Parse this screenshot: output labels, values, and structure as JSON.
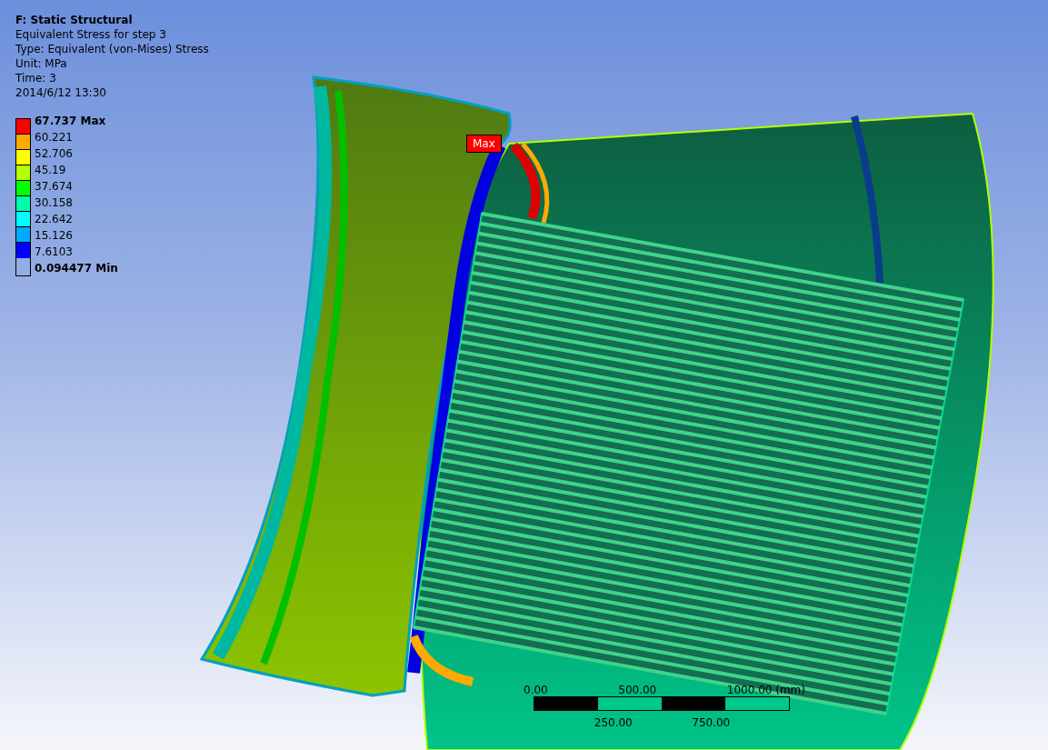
{
  "header": {
    "title": "F: Static Structural",
    "lines": [
      "Equivalent Stress for step 3",
      "Type: Equivalent (von-Mises) Stress",
      "Unit: MPa",
      "Time: 3",
      "2014/6/12 13:30"
    ]
  },
  "legend": {
    "labels": [
      "67.737 Max",
      "60.221",
      "52.706",
      "45.19",
      "37.674",
      "30.158",
      "22.642",
      "15.126",
      "7.6103",
      "0.094477 Min"
    ],
    "bands": [
      {
        "color": "#ff0000"
      },
      {
        "color": "#ffaa00"
      },
      {
        "color": "#ffff00"
      },
      {
        "color": "#b4ff00"
      },
      {
        "color": "#00ff00"
      },
      {
        "color": "#00ffaa"
      },
      {
        "color": "#00ffff"
      },
      {
        "color": "#00aaff"
      },
      {
        "color": "#0000ff"
      }
    ]
  },
  "probe": {
    "label": "Max"
  },
  "scale_bar": {
    "top_labels": [
      "0.00",
      "500.00",
      "1000.00 (mm)"
    ],
    "bottom_labels": [
      "250.00",
      "750.00"
    ]
  }
}
